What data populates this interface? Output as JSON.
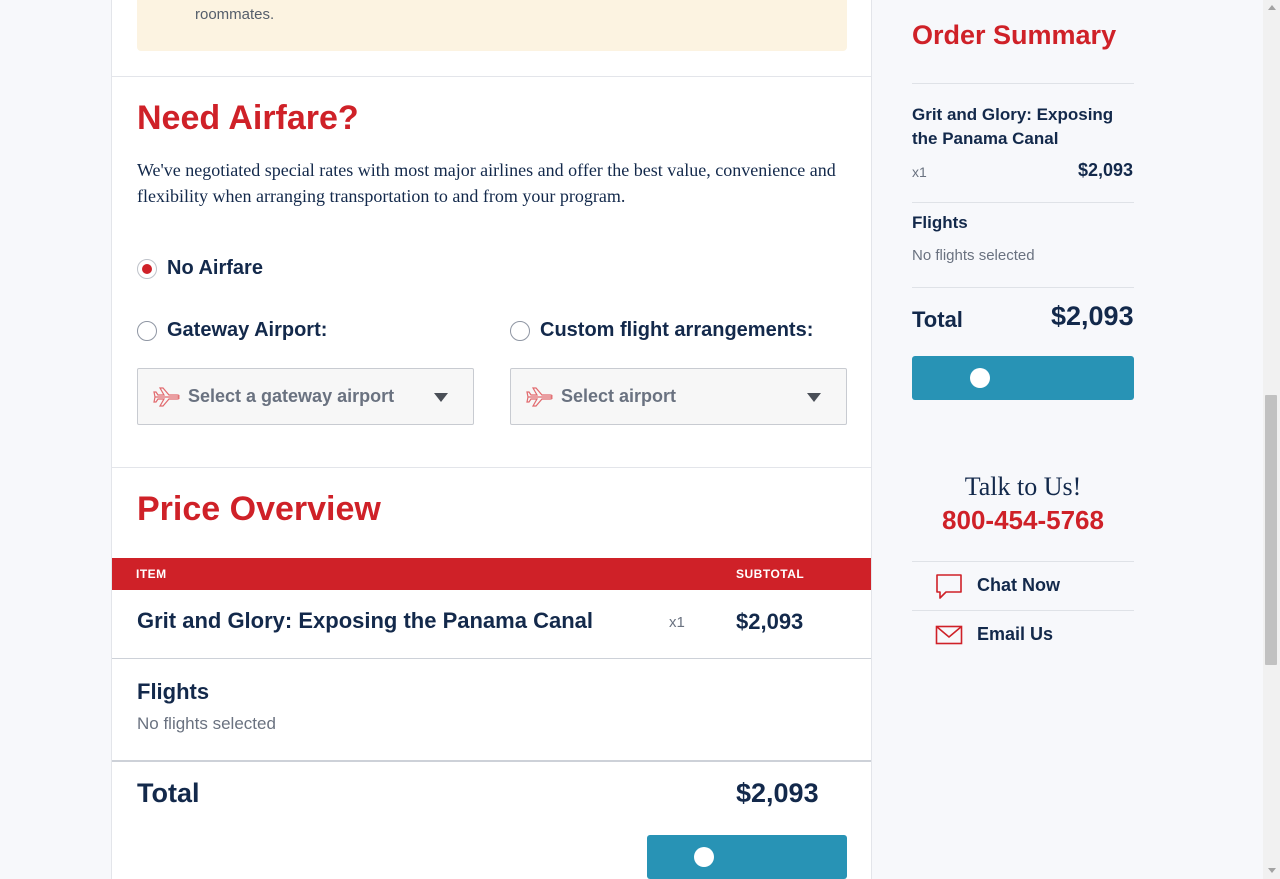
{
  "notice": {
    "text": "roommates."
  },
  "airfare": {
    "title": "Need Airfare?",
    "intro": "We've negotiated special rates with most major airlines and offer the best value, convenience and flexibility when arranging transportation to and from your program.",
    "options": {
      "no_airfare": "No Airfare",
      "gateway": "Gateway Airport:",
      "custom": "Custom flight arrangements:"
    },
    "selected": "no_airfare",
    "gateway_select": {
      "placeholder": "Select a gateway airport"
    },
    "custom_select": {
      "placeholder": "Select airport"
    }
  },
  "price_overview": {
    "title": "Price Overview",
    "columns": {
      "item": "ITEM",
      "subtotal": "SUBTOTAL"
    },
    "rows": [
      {
        "item": "Grit and Glory: Exposing the Panama Canal",
        "qty": "x1",
        "subtotal": "$2,093"
      }
    ],
    "flights": {
      "title": "Flights",
      "sub": "No flights selected"
    },
    "total": {
      "label": "Total",
      "value": "$2,093"
    }
  },
  "order_summary": {
    "title": "Order Summary",
    "item": "Grit and Glory: Exposing the Panama Canal",
    "qty": "x1",
    "price": "$2,093",
    "flights": {
      "title": "Flights",
      "sub": "No flights selected"
    },
    "total": {
      "label": "Total",
      "value": "$2,093"
    }
  },
  "contact": {
    "talk": "Talk to Us!",
    "phone": "800-454-5768",
    "chat": "Chat Now",
    "email": "Email Us"
  },
  "colors": {
    "brand_red": "#cf2128",
    "navy": "#13294b",
    "button_blue": "#2893b5",
    "notice_bg": "#fcf3e1"
  }
}
